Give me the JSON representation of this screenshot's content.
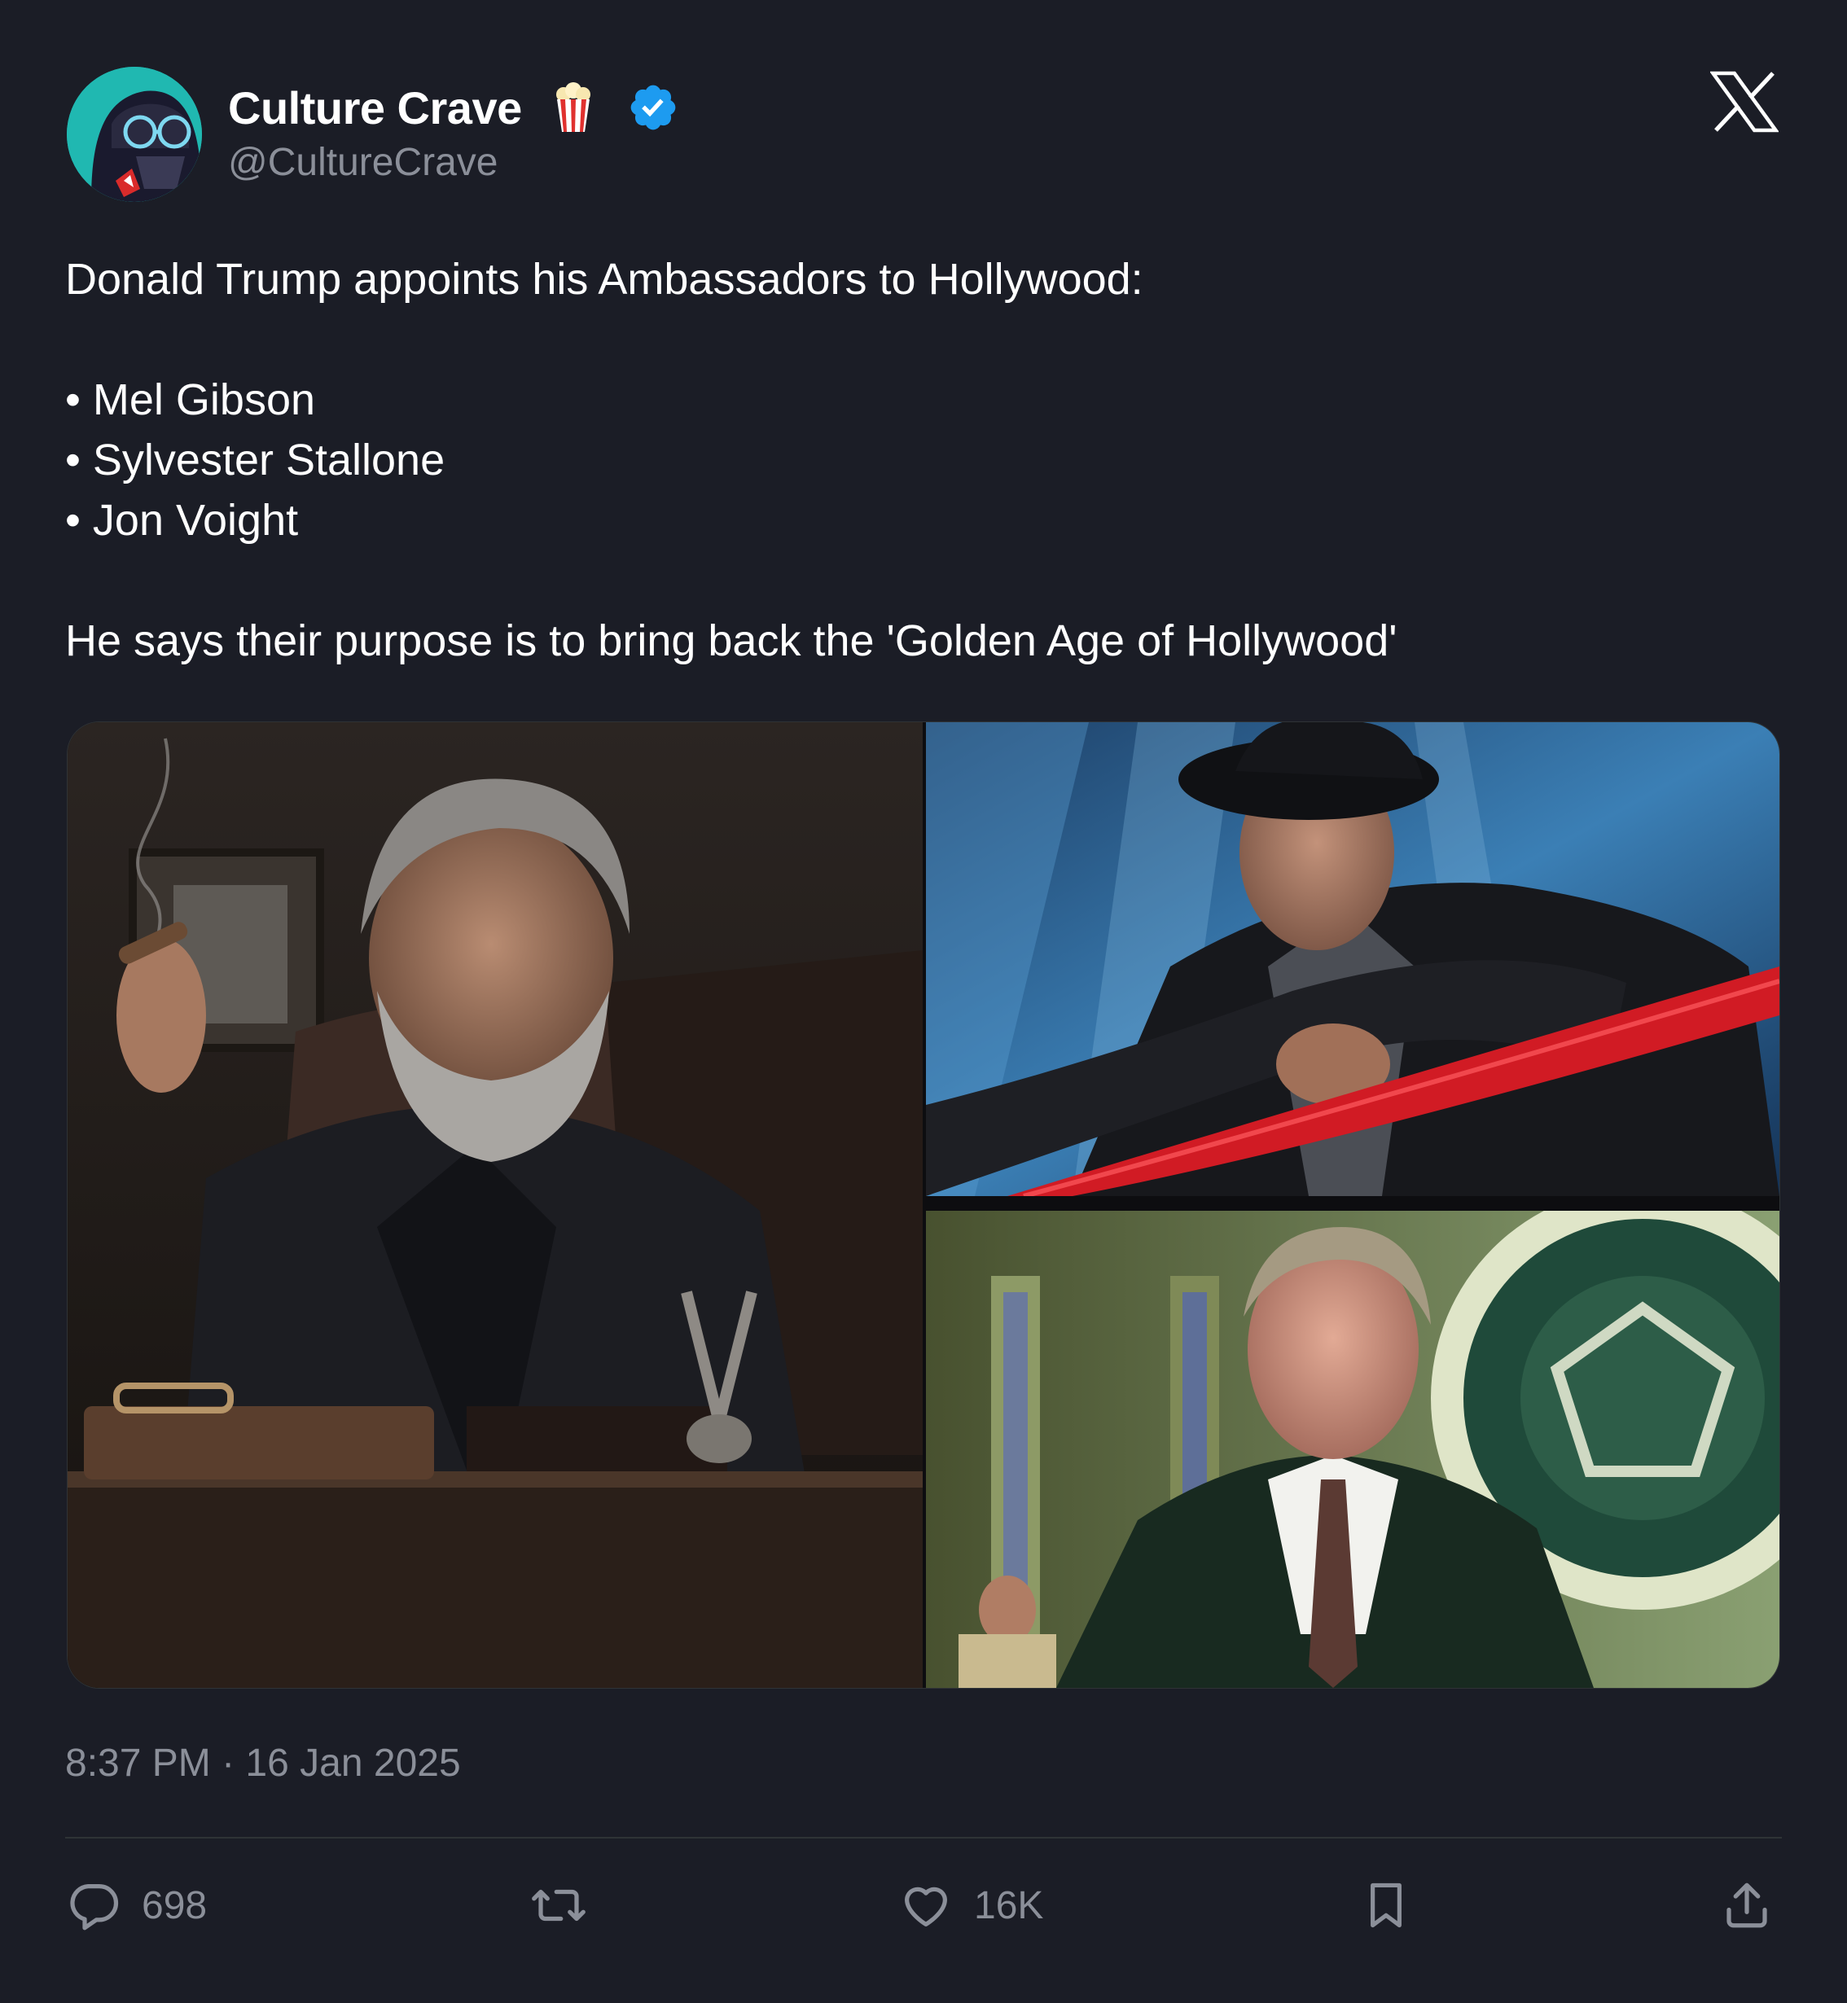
{
  "author": {
    "display_name": "Culture Crave",
    "handle": "@CultureCrave",
    "badge_emoji_icon": "popcorn-icon",
    "verified_icon": "verified-badge-icon",
    "verified_color": "#1d9bf0",
    "avatar_icon": "darth-vader-avatar"
  },
  "platform_logo_icon": "x-logo-icon",
  "tweet": {
    "intro": "Donald Trump appoints his Ambassadors to Hollywood:",
    "list": [
      "• Mel Gibson",
      "• Sylvester Stallone",
      "• Jon Voight"
    ],
    "closing": "He says their purpose is to bring back the 'Golden Age of Hollywood'"
  },
  "timestamp": "8:37 PM · 16 Jan 2025",
  "actions": {
    "reply": {
      "icon": "reply-icon",
      "count": "698"
    },
    "retweet": {
      "icon": "retweet-icon",
      "count": ""
    },
    "like": {
      "icon": "heart-icon",
      "count": "16K"
    },
    "bookmark": {
      "icon": "bookmark-icon"
    },
    "share": {
      "icon": "share-icon"
    }
  },
  "colors": {
    "background": "#1b1d26",
    "text": "#ffffff",
    "muted": "#8b8f99",
    "accent": "#1d9bf0"
  }
}
